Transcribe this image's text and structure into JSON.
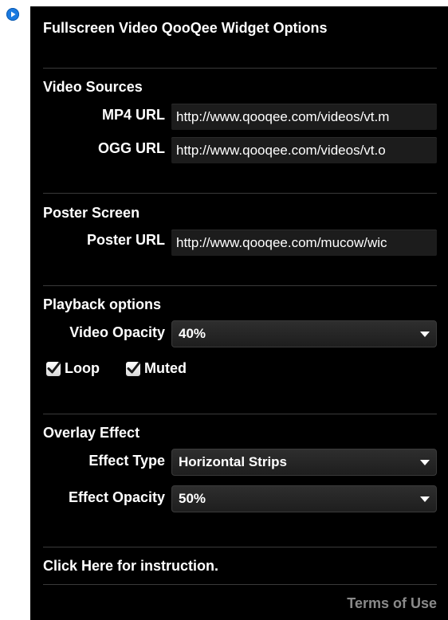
{
  "panel": {
    "title": "Fullscreen Video QooQee Widget Options"
  },
  "video_sources": {
    "title": "Video Sources",
    "mp4_label": "MP4 URL",
    "mp4_value": "http://www.qooqee.com/videos/vt.m",
    "ogg_label": "OGG URL",
    "ogg_value": "http://www.qooqee.com/videos/vt.o"
  },
  "poster_screen": {
    "title": "Poster Screen",
    "poster_label": "Poster URL",
    "poster_value": "http://www.qooqee.com/mucow/wic"
  },
  "playback": {
    "title": "Playback options",
    "opacity_label": "Video Opacity",
    "opacity_value": "40%",
    "loop_label": "Loop",
    "loop_checked": true,
    "muted_label": "Muted",
    "muted_checked": true
  },
  "overlay": {
    "title": "Overlay Effect",
    "effect_type_label": "Effect Type",
    "effect_type_value": "Horizontal Strips",
    "effect_opacity_label": "Effect Opacity",
    "effect_opacity_value": "50%"
  },
  "footer": {
    "instruction_link": "Click Here for instruction.",
    "terms_link": "Terms of Use"
  },
  "colors": {
    "panel_bg": "#000000",
    "accent_badge": "#1a7ae0",
    "muted_link": "#8a8a8a"
  },
  "icons": [
    "play-icon",
    "checkmark-icon",
    "chevron-down-icon"
  ]
}
